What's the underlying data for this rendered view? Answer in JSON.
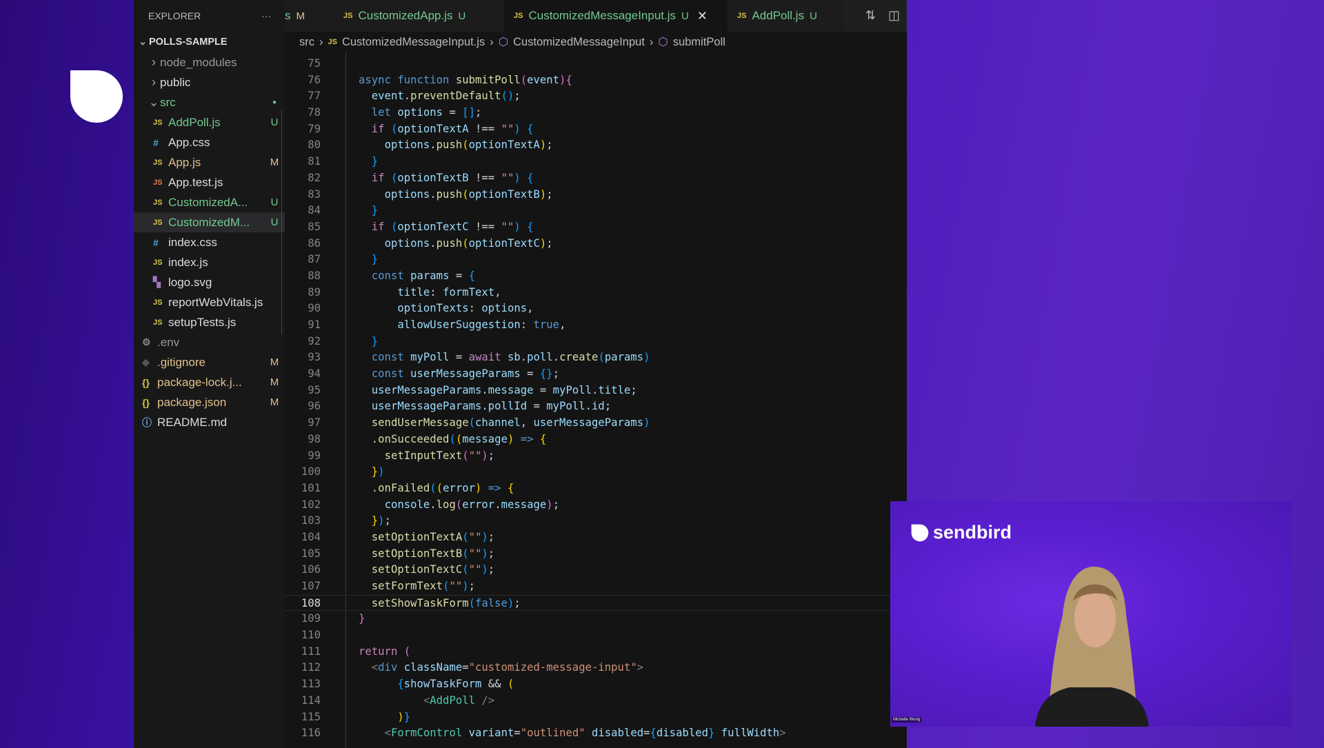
{
  "colors": {
    "untracked": "#73c991",
    "modified": "#e2c08d",
    "brand": "#6210cc"
  },
  "logo_text": "sendbird",
  "sidebar": {
    "title": "EXPLORER",
    "more": "···",
    "root": "POLLS-SAMPLE",
    "items": [
      {
        "label": "node_modules",
        "type": "folder",
        "open": false,
        "depth": 0,
        "status": "",
        "dim": true
      },
      {
        "label": "public",
        "type": "folder",
        "open": false,
        "depth": 0,
        "status": ""
      },
      {
        "label": "src",
        "type": "folder",
        "open": true,
        "depth": 0,
        "status": "●",
        "tone": "u"
      },
      {
        "label": "AddPoll.js",
        "type": "js",
        "depth": 1,
        "status": "U",
        "tone": "u"
      },
      {
        "label": "App.css",
        "type": "css",
        "depth": 1,
        "status": ""
      },
      {
        "label": "App.js",
        "type": "js",
        "depth": 1,
        "status": "M",
        "tone": "m"
      },
      {
        "label": "App.test.js",
        "type": "test",
        "depth": 1,
        "status": ""
      },
      {
        "label": "CustomizedA...",
        "type": "js",
        "depth": 1,
        "status": "U",
        "tone": "u"
      },
      {
        "label": "CustomizedM...",
        "type": "js",
        "depth": 1,
        "status": "U",
        "tone": "u",
        "selected": true
      },
      {
        "label": "index.css",
        "type": "css",
        "depth": 1,
        "status": ""
      },
      {
        "label": "index.js",
        "type": "js",
        "depth": 1,
        "status": ""
      },
      {
        "label": "logo.svg",
        "type": "svg",
        "depth": 1,
        "status": ""
      },
      {
        "label": "reportWebVitals.js",
        "type": "js",
        "depth": 1,
        "status": ""
      },
      {
        "label": "setupTests.js",
        "type": "js",
        "depth": 1,
        "status": ""
      },
      {
        "label": ".env",
        "type": "env",
        "depth": 0,
        "status": "",
        "dim": true
      },
      {
        "label": ".gitignore",
        "type": "git",
        "depth": 0,
        "status": "M",
        "tone": "m"
      },
      {
        "label": "package-lock.j...",
        "type": "json",
        "depth": 0,
        "status": "M",
        "tone": "m"
      },
      {
        "label": "package.json",
        "type": "json",
        "depth": 0,
        "status": "M",
        "tone": "m"
      },
      {
        "label": "README.md",
        "type": "info",
        "depth": 0,
        "status": ""
      }
    ]
  },
  "tabs": [
    {
      "label": "s",
      "status": "M",
      "partial": true
    },
    {
      "label": "CustomizedApp.js",
      "status": "U"
    },
    {
      "label": "CustomizedMessageInput.js",
      "status": "U",
      "active": true,
      "close": "✕"
    },
    {
      "label": "AddPoll.js",
      "status": "U"
    }
  ],
  "breadcrumb": [
    "src",
    "CustomizedMessageInput.js",
    "CustomizedMessageInput",
    "submitPoll"
  ],
  "editor": {
    "current_line": 108,
    "lines": [
      {
        "n": 75,
        "i": 0,
        "t": []
      },
      {
        "n": 76,
        "i": 0,
        "t": [
          [
            "async ",
            "k"
          ],
          [
            "function ",
            "k"
          ],
          [
            "submitPoll",
            "f"
          ],
          [
            "(",
            "b2"
          ],
          [
            "event",
            "v"
          ],
          [
            ")",
            "b2"
          ],
          [
            "{",
            "b2"
          ]
        ]
      },
      {
        "n": 77,
        "i": 2,
        "t": [
          [
            "event",
            "v"
          ],
          [
            ".",
            "p"
          ],
          [
            "preventDefault",
            "f"
          ],
          [
            "()",
            "b3"
          ],
          [
            ";",
            "p"
          ]
        ]
      },
      {
        "n": 78,
        "i": 2,
        "t": [
          [
            "let ",
            "k"
          ],
          [
            "options",
            "v"
          ],
          [
            " = ",
            "p"
          ],
          [
            "[]",
            "b3"
          ],
          [
            ";",
            "p"
          ]
        ]
      },
      {
        "n": 79,
        "i": 2,
        "t": [
          [
            "if ",
            "c"
          ],
          [
            "(",
            "b3"
          ],
          [
            "optionTextA",
            "v"
          ],
          [
            " !== ",
            "p"
          ],
          [
            "\"\"",
            "s"
          ],
          [
            ")",
            "b3"
          ],
          [
            " {",
            "b3"
          ]
        ]
      },
      {
        "n": 80,
        "i": 4,
        "t": [
          [
            "options",
            "v"
          ],
          [
            ".",
            "p"
          ],
          [
            "push",
            "f"
          ],
          [
            "(",
            "b1"
          ],
          [
            "optionTextA",
            "v"
          ],
          [
            ")",
            "b1"
          ],
          [
            ";",
            "p"
          ]
        ]
      },
      {
        "n": 81,
        "i": 2,
        "t": [
          [
            "}",
            "b3"
          ]
        ]
      },
      {
        "n": 82,
        "i": 2,
        "t": [
          [
            "if ",
            "c"
          ],
          [
            "(",
            "b3"
          ],
          [
            "optionTextB",
            "v"
          ],
          [
            " !== ",
            "p"
          ],
          [
            "\"\"",
            "s"
          ],
          [
            ")",
            "b3"
          ],
          [
            " {",
            "b3"
          ]
        ]
      },
      {
        "n": 83,
        "i": 4,
        "t": [
          [
            "options",
            "v"
          ],
          [
            ".",
            "p"
          ],
          [
            "push",
            "f"
          ],
          [
            "(",
            "b1"
          ],
          [
            "optionTextB",
            "v"
          ],
          [
            ")",
            "b1"
          ],
          [
            ";",
            "p"
          ]
        ]
      },
      {
        "n": 84,
        "i": 2,
        "t": [
          [
            "}",
            "b3"
          ]
        ]
      },
      {
        "n": 85,
        "i": 2,
        "t": [
          [
            "if ",
            "c"
          ],
          [
            "(",
            "b3"
          ],
          [
            "optionTextC",
            "v"
          ],
          [
            " !== ",
            "p"
          ],
          [
            "\"\"",
            "s"
          ],
          [
            ")",
            "b3"
          ],
          [
            " {",
            "b3"
          ]
        ]
      },
      {
        "n": 86,
        "i": 4,
        "t": [
          [
            "options",
            "v"
          ],
          [
            ".",
            "p"
          ],
          [
            "push",
            "f"
          ],
          [
            "(",
            "b1"
          ],
          [
            "optionTextC",
            "v"
          ],
          [
            ")",
            "b1"
          ],
          [
            ";",
            "p"
          ]
        ]
      },
      {
        "n": 87,
        "i": 2,
        "t": [
          [
            "}",
            "b3"
          ]
        ]
      },
      {
        "n": 88,
        "i": 2,
        "t": [
          [
            "const ",
            "k"
          ],
          [
            "params",
            "v"
          ],
          [
            " = ",
            "p"
          ],
          [
            "{",
            "b3"
          ]
        ]
      },
      {
        "n": 89,
        "i": 6,
        "t": [
          [
            "title",
            "v"
          ],
          [
            ": ",
            "p"
          ],
          [
            "formText",
            "v"
          ],
          [
            ",",
            "p"
          ]
        ]
      },
      {
        "n": 90,
        "i": 6,
        "t": [
          [
            "optionTexts",
            "v"
          ],
          [
            ": ",
            "p"
          ],
          [
            "options",
            "v"
          ],
          [
            ",",
            "p"
          ]
        ]
      },
      {
        "n": 91,
        "i": 6,
        "t": [
          [
            "allowUserSuggestion",
            "v"
          ],
          [
            ": ",
            "p"
          ],
          [
            "true",
            "k"
          ],
          [
            ",",
            "p"
          ]
        ]
      },
      {
        "n": 92,
        "i": 2,
        "t": [
          [
            "}",
            "b3"
          ]
        ]
      },
      {
        "n": 93,
        "i": 2,
        "t": [
          [
            "const ",
            "k"
          ],
          [
            "myPoll",
            "v"
          ],
          [
            " = ",
            "p"
          ],
          [
            "await ",
            "c"
          ],
          [
            "sb",
            "v"
          ],
          [
            ".",
            "p"
          ],
          [
            "poll",
            "v"
          ],
          [
            ".",
            "p"
          ],
          [
            "create",
            "f"
          ],
          [
            "(",
            "b3"
          ],
          [
            "params",
            "v"
          ],
          [
            ")",
            "b3"
          ]
        ]
      },
      {
        "n": 94,
        "i": 2,
        "t": [
          [
            "const ",
            "k"
          ],
          [
            "userMessageParams",
            "v"
          ],
          [
            " = ",
            "p"
          ],
          [
            "{}",
            "b3"
          ],
          [
            ";",
            "p"
          ]
        ]
      },
      {
        "n": 95,
        "i": 2,
        "t": [
          [
            "userMessageParams",
            "v"
          ],
          [
            ".",
            "p"
          ],
          [
            "message",
            "v"
          ],
          [
            " = ",
            "p"
          ],
          [
            "myPoll",
            "v"
          ],
          [
            ".",
            "p"
          ],
          [
            "title",
            "v"
          ],
          [
            ";",
            "p"
          ]
        ]
      },
      {
        "n": 96,
        "i": 2,
        "t": [
          [
            "userMessageParams",
            "v"
          ],
          [
            ".",
            "p"
          ],
          [
            "pollId",
            "v"
          ],
          [
            " = ",
            "p"
          ],
          [
            "myPoll",
            "v"
          ],
          [
            ".",
            "p"
          ],
          [
            "id",
            "v"
          ],
          [
            ";",
            "p"
          ]
        ]
      },
      {
        "n": 97,
        "i": 2,
        "t": [
          [
            "sendUserMessage",
            "f"
          ],
          [
            "(",
            "b3"
          ],
          [
            "channel",
            "v"
          ],
          [
            ", ",
            "p"
          ],
          [
            "userMessageParams",
            "v"
          ],
          [
            ")",
            "b3"
          ]
        ]
      },
      {
        "n": 98,
        "i": 2,
        "t": [
          [
            ".",
            "p"
          ],
          [
            "onSucceeded",
            "f"
          ],
          [
            "(",
            "b3"
          ],
          [
            "(",
            "b1"
          ],
          [
            "message",
            "v"
          ],
          [
            ")",
            "b1"
          ],
          [
            " => ",
            "k"
          ],
          [
            "{",
            "b1"
          ]
        ]
      },
      {
        "n": 99,
        "i": 4,
        "t": [
          [
            "setInputText",
            "f"
          ],
          [
            "(",
            "b2"
          ],
          [
            "\"\"",
            "s"
          ],
          [
            ")",
            "b2"
          ],
          [
            ";",
            "p"
          ]
        ]
      },
      {
        "n": 100,
        "i": 2,
        "t": [
          [
            "}",
            "b1"
          ],
          [
            ")",
            "b3"
          ]
        ]
      },
      {
        "n": 101,
        "i": 2,
        "t": [
          [
            ".",
            "p"
          ],
          [
            "onFailed",
            "f"
          ],
          [
            "(",
            "b3"
          ],
          [
            "(",
            "b1"
          ],
          [
            "error",
            "v"
          ],
          [
            ")",
            "b1"
          ],
          [
            " => ",
            "k"
          ],
          [
            "{",
            "b1"
          ]
        ]
      },
      {
        "n": 102,
        "i": 4,
        "t": [
          [
            "console",
            "v"
          ],
          [
            ".",
            "p"
          ],
          [
            "log",
            "f"
          ],
          [
            "(",
            "b2"
          ],
          [
            "error",
            "v"
          ],
          [
            ".",
            "p"
          ],
          [
            "message",
            "v"
          ],
          [
            ")",
            "b2"
          ],
          [
            ";",
            "p"
          ]
        ]
      },
      {
        "n": 103,
        "i": 2,
        "t": [
          [
            "}",
            "b1"
          ],
          [
            ")",
            "b3"
          ],
          [
            ";",
            "p"
          ]
        ]
      },
      {
        "n": 104,
        "i": 2,
        "t": [
          [
            "setOptionTextA",
            "f"
          ],
          [
            "(",
            "b3"
          ],
          [
            "\"\"",
            "s"
          ],
          [
            ")",
            "b3"
          ],
          [
            ";",
            "p"
          ]
        ]
      },
      {
        "n": 105,
        "i": 2,
        "t": [
          [
            "setOptionTextB",
            "f"
          ],
          [
            "(",
            "b3"
          ],
          [
            "\"\"",
            "s"
          ],
          [
            ")",
            "b3"
          ],
          [
            ";",
            "p"
          ]
        ]
      },
      {
        "n": 106,
        "i": 2,
        "t": [
          [
            "setOptionTextC",
            "f"
          ],
          [
            "(",
            "b3"
          ],
          [
            "\"\"",
            "s"
          ],
          [
            ")",
            "b3"
          ],
          [
            ";",
            "p"
          ]
        ]
      },
      {
        "n": 107,
        "i": 2,
        "t": [
          [
            "setFormText",
            "f"
          ],
          [
            "(",
            "b3"
          ],
          [
            "\"\"",
            "s"
          ],
          [
            ")",
            "b3"
          ],
          [
            ";",
            "p"
          ]
        ]
      },
      {
        "n": 108,
        "i": 2,
        "t": [
          [
            "setShowTaskForm",
            "f"
          ],
          [
            "(",
            "b3"
          ],
          [
            "false",
            "k"
          ],
          [
            ")",
            "b3"
          ],
          [
            ";",
            "p"
          ]
        ]
      },
      {
        "n": 109,
        "i": 0,
        "t": [
          [
            "}",
            "b2"
          ]
        ]
      },
      {
        "n": 110,
        "i": 0,
        "t": []
      },
      {
        "n": 111,
        "i": 0,
        "t": [
          [
            "return ",
            "c"
          ],
          [
            "(",
            "b2"
          ]
        ]
      },
      {
        "n": 112,
        "i": 2,
        "t": [
          [
            "<",
            "tag"
          ],
          [
            "div",
            "k"
          ],
          [
            " ",
            "p"
          ],
          [
            "className",
            "v"
          ],
          [
            "=",
            "p"
          ],
          [
            "\"customized-message-input\"",
            "s"
          ],
          [
            ">",
            "tag"
          ]
        ]
      },
      {
        "n": 113,
        "i": 6,
        "t": [
          [
            "{",
            "b3"
          ],
          [
            "showTaskForm",
            "v"
          ],
          [
            " && ",
            "p"
          ],
          [
            "(",
            "b1"
          ]
        ]
      },
      {
        "n": 114,
        "i": 10,
        "t": [
          [
            "<",
            "tag"
          ],
          [
            "AddPoll",
            "cmp"
          ],
          [
            " />",
            "tag"
          ]
        ]
      },
      {
        "n": 115,
        "i": 6,
        "t": [
          [
            ")",
            "b1"
          ],
          [
            "}",
            "b3"
          ]
        ]
      },
      {
        "n": 116,
        "i": 4,
        "t": [
          [
            "<",
            "tag"
          ],
          [
            "FormControl",
            "cmp"
          ],
          [
            " ",
            "p"
          ],
          [
            "variant",
            "v"
          ],
          [
            "=",
            "p"
          ],
          [
            "\"outlined\"",
            "s"
          ],
          [
            " ",
            "p"
          ],
          [
            "disabled",
            "v"
          ],
          [
            "=",
            "p"
          ],
          [
            "{",
            "b3"
          ],
          [
            "disabled",
            "v"
          ],
          [
            "}",
            "b3"
          ],
          [
            " ",
            "p"
          ],
          [
            "fullWidth",
            "v"
          ],
          [
            ">",
            "tag"
          ]
        ]
      }
    ]
  },
  "video": {
    "brand": "sendbird",
    "participant_name": "Michelle Wong"
  }
}
